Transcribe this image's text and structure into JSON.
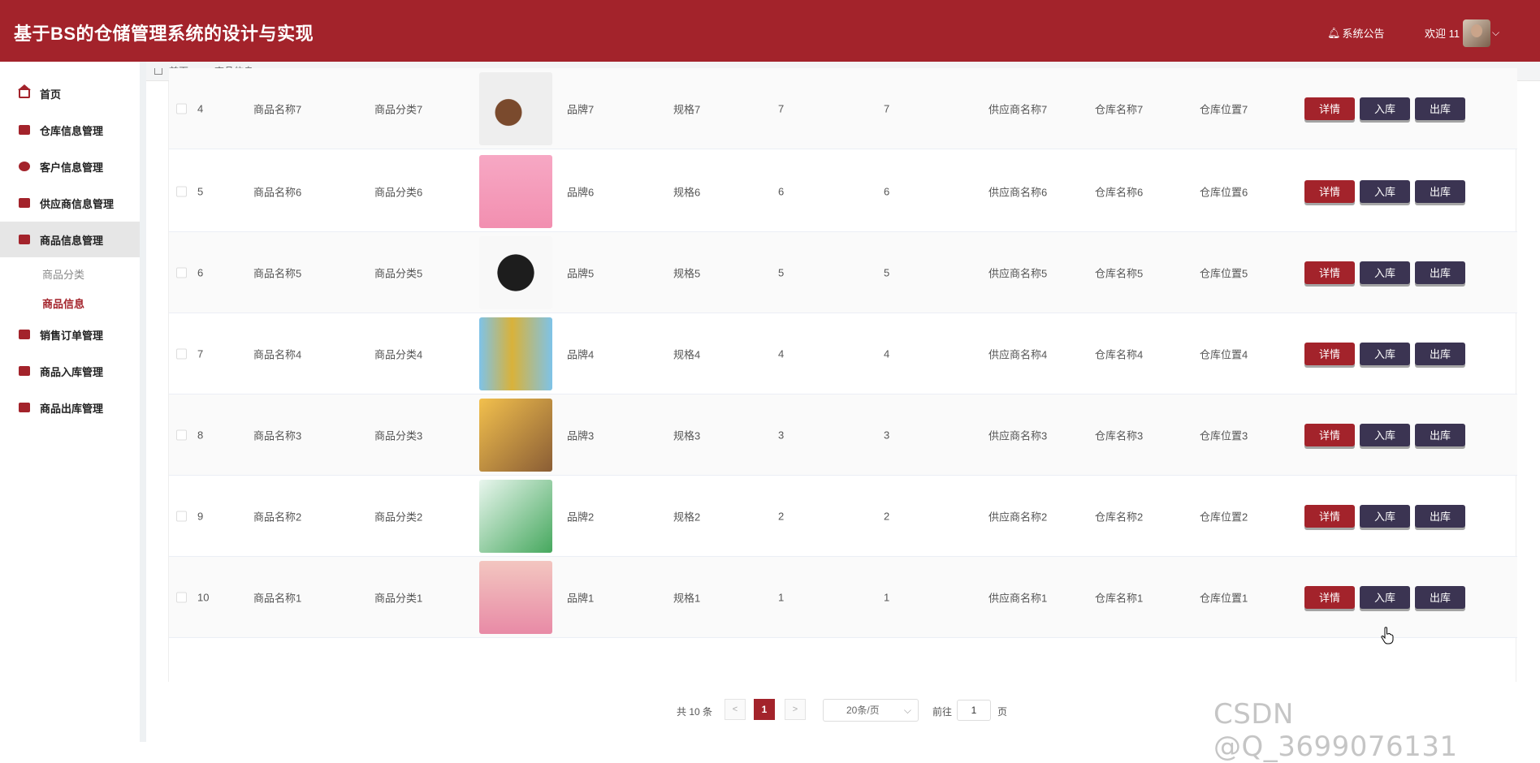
{
  "app": {
    "title": "基于BS的仓储管理系统的设计与实现",
    "notice": "系统公告",
    "welcome": "欢迎 11"
  },
  "colors": {
    "primary": "#a3232b",
    "secondary": "#3b3452"
  },
  "sidebar": {
    "items": [
      {
        "label": "首页",
        "icon": "home-icon"
      },
      {
        "label": "仓库信息管理",
        "icon": "ticket-icon"
      },
      {
        "label": "客户信息管理",
        "icon": "compass-icon"
      },
      {
        "label": "供应商信息管理",
        "icon": "box-icon"
      },
      {
        "label": "商品信息管理",
        "icon": "gift-icon"
      },
      {
        "label": "销售订单管理",
        "icon": "ticket-icon"
      },
      {
        "label": "商品入库管理",
        "icon": "table-icon"
      },
      {
        "label": "商品出库管理",
        "icon": "square-icon"
      }
    ],
    "subitems": [
      {
        "label": "商品分类"
      },
      {
        "label": "商品信息"
      }
    ]
  },
  "breadcrumb": {
    "home": "首页",
    "separator": "—",
    "current": "商品信息"
  },
  "table": {
    "actions": {
      "detail": "详情",
      "in": "入库",
      "out": "出库"
    },
    "rows": [
      {
        "index": "4",
        "name": "商品名称7",
        "category": "商品分类7",
        "brand": "品牌7",
        "spec": "规格7",
        "q1": "7",
        "q2": "7",
        "supplier": "供应商名称7",
        "warehouse": "仓库名称7",
        "location": "仓库位置7",
        "image": "chocolate-photo"
      },
      {
        "index": "5",
        "name": "商品名称6",
        "category": "商品分类6",
        "brand": "品牌6",
        "spec": "规格6",
        "q1": "6",
        "q2": "6",
        "supplier": "供应商名称6",
        "warehouse": "仓库名称6",
        "location": "仓库位置6",
        "image": "noodle-pack-photo"
      },
      {
        "index": "6",
        "name": "商品名称5",
        "category": "商品分类5",
        "brand": "品牌5",
        "spec": "规格5",
        "q1": "5",
        "q2": "5",
        "supplier": "供应商名称5",
        "warehouse": "仓库名称5",
        "location": "仓库位置5",
        "image": "black-bag-photo"
      },
      {
        "index": "7",
        "name": "商品名称4",
        "category": "商品分类4",
        "brand": "品牌4",
        "spec": "规格4",
        "q1": "4",
        "q2": "4",
        "supplier": "供应商名称4",
        "warehouse": "仓库名称4",
        "location": "仓库位置4",
        "image": "toilet-brush-photo"
      },
      {
        "index": "8",
        "name": "商品名称3",
        "category": "商品分类3",
        "brand": "品牌3",
        "spec": "规格3",
        "q1": "3",
        "q2": "3",
        "supplier": "供应商名称3",
        "warehouse": "仓库名称3",
        "location": "仓库位置3",
        "image": "snack-photo"
      },
      {
        "index": "9",
        "name": "商品名称2",
        "category": "商品分类2",
        "brand": "品牌2",
        "spec": "规格2",
        "q1": "2",
        "q2": "2",
        "supplier": "供应商名称2",
        "warehouse": "仓库名称2",
        "location": "仓库位置2",
        "image": "milk-pack-photo"
      },
      {
        "index": "10",
        "name": "商品名称1",
        "category": "商品分类1",
        "brand": "品牌1",
        "spec": "规格1",
        "q1": "1",
        "q2": "1",
        "supplier": "供应商名称1",
        "warehouse": "仓库名称1",
        "location": "仓库位置1",
        "image": "game-console-photo"
      }
    ]
  },
  "pagination": {
    "total": "共 10 条",
    "prev": "<",
    "page": "1",
    "next": ">",
    "page_size": "20条/页",
    "goto": "前往",
    "goto_value": "1",
    "unit": "页"
  },
  "watermark": "CSDN @Q_3699076131"
}
